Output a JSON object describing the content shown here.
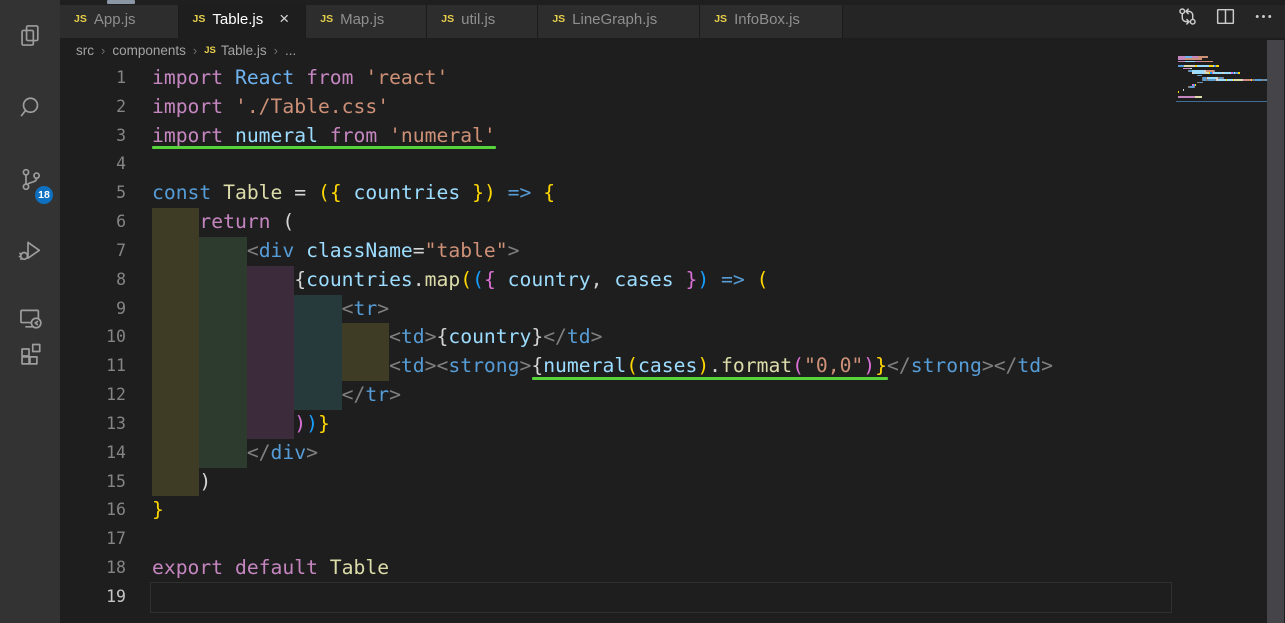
{
  "palette": {
    "kw": "#C586C0",
    "kb": "#569CD6",
    "st": "#CE9178",
    "vr": "#9CDCFE",
    "fn": "#DCDCAA",
    "tg": "#569CD6",
    "pn": "#808080",
    "fg": "#D4D4D4",
    "b1": "#FFD700",
    "b2": "#DA70D6",
    "b3": "#179FFF",
    "rc": "#6FB3F0"
  },
  "indent_colors": [
    "#3f3c26",
    "#2d3b2f",
    "#3b2b3b",
    "#263a3c",
    "#3f3c26"
  ],
  "ui": {
    "underline_color": "#57d43c",
    "badge_color": "#0e70c0",
    "js_icon_color": "#e6ce4b"
  },
  "activity_bar": {
    "badge": "18",
    "items": [
      {
        "name": "explorer",
        "icon": "files-icon"
      },
      {
        "name": "search",
        "icon": "search-icon"
      },
      {
        "name": "source-control",
        "icon": "source-control-icon",
        "badge": "18"
      },
      {
        "name": "run-debug",
        "icon": "debug-icon"
      },
      {
        "name": "remote-explorer",
        "icon": "remote-icon"
      },
      {
        "name": "extensions",
        "icon": "extensions-icon"
      }
    ]
  },
  "tab_bar": {
    "close_glyph": "×",
    "js_glyph": "JS",
    "tabs": [
      {
        "label": "App.js",
        "active": false
      },
      {
        "label": "Table.js",
        "active": true
      },
      {
        "label": "Map.js",
        "active": false
      },
      {
        "label": "util.js",
        "active": false
      },
      {
        "label": "LineGraph.js",
        "active": false
      },
      {
        "label": "InfoBox.js",
        "active": false
      }
    ],
    "actions": [
      {
        "name": "open-changes",
        "icon": "compare-changes-icon"
      },
      {
        "name": "split-editor",
        "icon": "split-editor-icon"
      },
      {
        "name": "more-actions",
        "icon": "ellipsis-icon"
      }
    ]
  },
  "breadcrumb": {
    "separator": "›",
    "items": [
      {
        "label": "src"
      },
      {
        "label": "components"
      },
      {
        "label": "Table.js",
        "icon": "js"
      },
      {
        "label": "..."
      }
    ]
  },
  "editor": {
    "lines": [
      {
        "num": 1,
        "ind": 0,
        "bl": 0,
        "tokens": [
          [
            "import",
            "kw"
          ],
          [
            " React",
            "rc"
          ],
          [
            " from",
            "kw"
          ],
          [
            " 'react'",
            "st"
          ]
        ]
      },
      {
        "num": 2,
        "ind": 0,
        "bl": 0,
        "tokens": [
          [
            "import",
            "kw"
          ],
          [
            " './Table.css'",
            "st"
          ]
        ]
      },
      {
        "num": 3,
        "ind": 0,
        "bl": 0,
        "ul": [
          0,
          29
        ],
        "tokens": [
          [
            "import",
            "kw"
          ],
          [
            " numeral",
            "vr"
          ],
          [
            " from",
            "kw"
          ],
          [
            " 'numeral'",
            "st"
          ]
        ]
      },
      {
        "num": 4,
        "ind": 0,
        "bl": 0,
        "tokens": []
      },
      {
        "num": 5,
        "ind": 0,
        "bl": 0,
        "tokens": [
          [
            "const",
            "kb"
          ],
          [
            " Table",
            "fn"
          ],
          [
            " ",
            "fg"
          ],
          [
            "=",
            "fg"
          ],
          [
            " ",
            "fg"
          ],
          [
            "(",
            "b1"
          ],
          [
            "{",
            "b1"
          ],
          [
            " countries",
            "vr"
          ],
          [
            " }",
            "b1"
          ],
          [
            ")",
            "b1"
          ],
          [
            " ",
            "fg"
          ],
          [
            "=>",
            "kb"
          ],
          [
            " {",
            "b1"
          ]
        ]
      },
      {
        "num": 6,
        "ind": 4,
        "bl": 1,
        "tokens": [
          [
            "return",
            "kw"
          ],
          [
            " (",
            "fg"
          ]
        ]
      },
      {
        "num": 7,
        "ind": 8,
        "bl": 2,
        "tokens": [
          [
            "<",
            "pn"
          ],
          [
            "div",
            "tg"
          ],
          [
            " className",
            "vr"
          ],
          [
            "=",
            "fg"
          ],
          [
            "\"table\"",
            "st"
          ],
          [
            ">",
            "pn"
          ]
        ]
      },
      {
        "num": 8,
        "ind": 12,
        "bl": 3,
        "tokens": [
          [
            "{",
            "fg"
          ],
          [
            "countries",
            "vr"
          ],
          [
            ".",
            "fg"
          ],
          [
            "map",
            "fn"
          ],
          [
            "(",
            "b1"
          ],
          [
            "(",
            "b3"
          ],
          [
            "{",
            "b2"
          ],
          [
            " country",
            "vr"
          ],
          [
            ",",
            "fg"
          ],
          [
            " cases",
            "vr"
          ],
          [
            " }",
            "b2"
          ],
          [
            ")",
            "b3"
          ],
          [
            " ",
            "fg"
          ],
          [
            "=>",
            "kb"
          ],
          [
            " (",
            "b1"
          ]
        ]
      },
      {
        "num": 9,
        "ind": 16,
        "bl": 4,
        "tokens": [
          [
            "<",
            "pn"
          ],
          [
            "tr",
            "tg"
          ],
          [
            ">",
            "pn"
          ]
        ]
      },
      {
        "num": 10,
        "ind": 20,
        "bl": 5,
        "tokens": [
          [
            "<",
            "pn"
          ],
          [
            "td",
            "tg"
          ],
          [
            ">",
            "pn"
          ],
          [
            "{",
            "fg"
          ],
          [
            "country",
            "vr"
          ],
          [
            "}",
            "fg"
          ],
          [
            "</",
            "pn"
          ],
          [
            "td",
            "tg"
          ],
          [
            ">",
            "pn"
          ]
        ]
      },
      {
        "num": 11,
        "ind": 20,
        "bl": 5,
        "ul": [
          32,
          62
        ],
        "tokens": [
          [
            "<",
            "pn"
          ],
          [
            "td",
            "tg"
          ],
          [
            ">",
            "pn"
          ],
          [
            "<",
            "pn"
          ],
          [
            "strong",
            "tg"
          ],
          [
            ">",
            "pn"
          ],
          [
            "{",
            "fg"
          ],
          [
            "numeral",
            "vr"
          ],
          [
            "(",
            "b1"
          ],
          [
            "cases",
            "vr"
          ],
          [
            ")",
            "b1"
          ],
          [
            ".",
            "fg"
          ],
          [
            "format",
            "fn"
          ],
          [
            "(",
            "b2"
          ],
          [
            "\"0,0\"",
            "st"
          ],
          [
            ")",
            "b2"
          ],
          [
            "}",
            "b1"
          ],
          [
            "</",
            "pn"
          ],
          [
            "strong",
            "tg"
          ],
          [
            ">",
            "pn"
          ],
          [
            "</",
            "pn"
          ],
          [
            "td",
            "tg"
          ],
          [
            ">",
            "pn"
          ]
        ]
      },
      {
        "num": 12,
        "ind": 16,
        "bl": 4,
        "tokens": [
          [
            "</",
            "pn"
          ],
          [
            "tr",
            "tg"
          ],
          [
            ">",
            "pn"
          ]
        ]
      },
      {
        "num": 13,
        "ind": 12,
        "bl": 3,
        "tokens": [
          [
            ")",
            "b2"
          ],
          [
            ")",
            "b3"
          ],
          [
            "}",
            "b1"
          ]
        ]
      },
      {
        "num": 14,
        "ind": 8,
        "bl": 2,
        "tokens": [
          [
            "</",
            "pn"
          ],
          [
            "div",
            "tg"
          ],
          [
            ">",
            "pn"
          ]
        ]
      },
      {
        "num": 15,
        "ind": 4,
        "bl": 1,
        "tokens": [
          [
            ")",
            "fg"
          ]
        ]
      },
      {
        "num": 16,
        "ind": 0,
        "bl": 0,
        "tokens": [
          [
            "}",
            "b1"
          ]
        ]
      },
      {
        "num": 17,
        "ind": 0,
        "bl": 0,
        "tokens": []
      },
      {
        "num": 18,
        "ind": 0,
        "bl": 0,
        "tokens": [
          [
            "export",
            "kw"
          ],
          [
            " default",
            "kw"
          ],
          [
            " Table",
            "fn"
          ]
        ]
      },
      {
        "num": 19,
        "ind": 0,
        "bl": 0,
        "current": true,
        "tokens": []
      }
    ]
  }
}
